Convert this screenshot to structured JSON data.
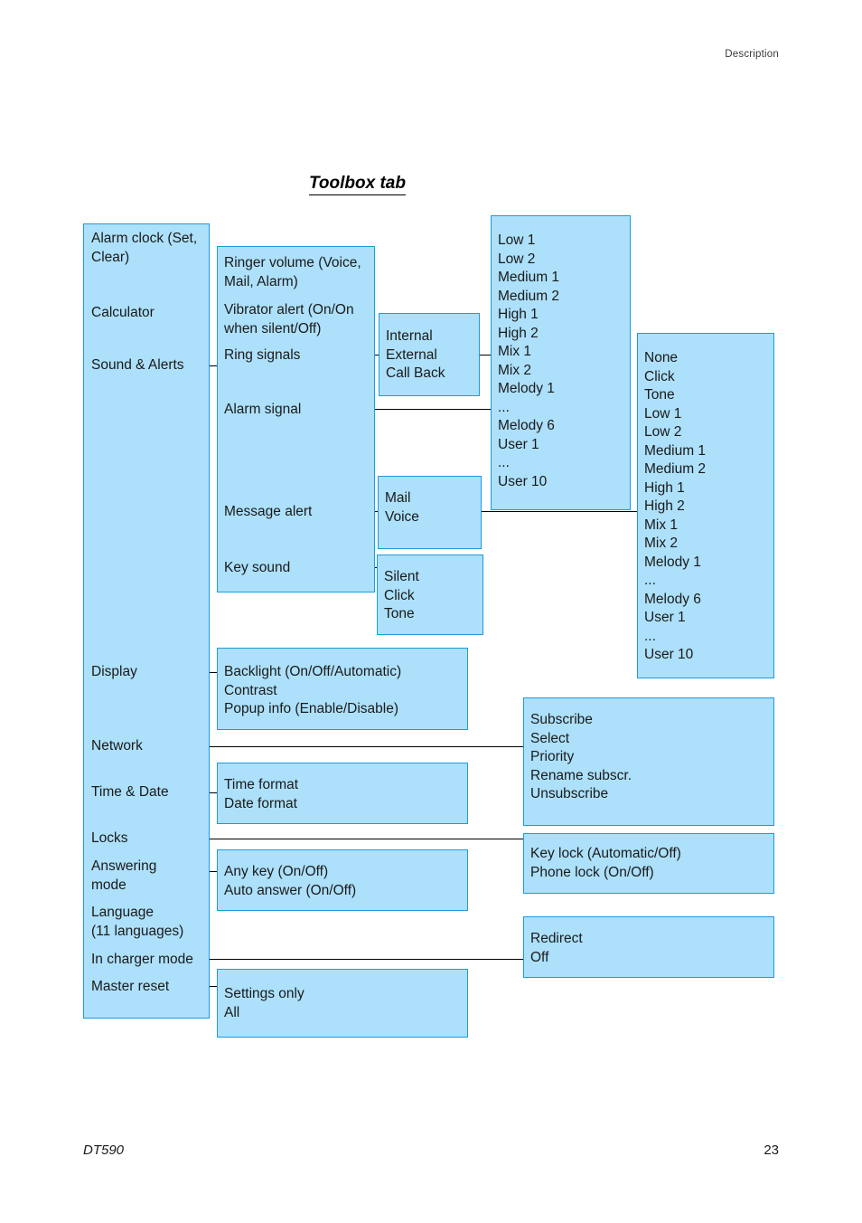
{
  "header": {
    "section_label": "Description"
  },
  "footer": {
    "document_name": "DT590",
    "page_number": "23"
  },
  "diagram": {
    "title": "Toolbox tab",
    "colors": {
      "box_fill": "#ade0fa",
      "box_border": "#1e9ae0",
      "connector": "#000000",
      "text": "#1a1a1a"
    },
    "level1_menu": {
      "items": [
        "Alarm clock (Set,\nClear)",
        "Calculator",
        "Sound & Alerts",
        "Display",
        "Network",
        "Time & Date",
        "Locks",
        "Answering\nmode",
        "Language\n(11 languages)",
        "In charger mode",
        "Master reset"
      ]
    },
    "sound_alerts_submenu": {
      "items": [
        "Ringer volume (Voice,\nMail, Alarm)",
        "Vibrator alert (On/On\nwhen silent/Off)",
        "Ring signals",
        "Alarm signal",
        "Message alert",
        "Key sound"
      ]
    },
    "ring_signals_types": {
      "items": [
        "Internal",
        "External",
        "Call Back"
      ]
    },
    "ring_signal_tones": {
      "items": [
        "Low 1",
        "Low 2",
        "Medium 1",
        "Medium 2",
        "High 1",
        "High 2",
        "Mix 1",
        "Mix 2",
        "Melody 1",
        "...",
        "Melody 6",
        "User 1",
        "...",
        "User 10"
      ]
    },
    "message_alert_types": {
      "items": [
        "Mail",
        "Voice"
      ]
    },
    "message_alert_tones": {
      "items": [
        "None",
        "Click",
        "Tone",
        "Low 1",
        "Low 2",
        "Medium 1",
        "Medium 2",
        "High 1",
        "High 2",
        "Mix 1",
        "Mix 2",
        "Melody 1",
        "...",
        "Melody 6",
        "User 1",
        "...",
        "User 10"
      ]
    },
    "key_sound_options": {
      "items": [
        "Silent",
        "Click",
        "Tone"
      ]
    },
    "display_options": {
      "items": [
        "Backlight (On/Off/Automatic)",
        "Contrast",
        "Popup info (Enable/Disable)"
      ]
    },
    "network_options": {
      "items": [
        "Subscribe",
        "Select",
        "Priority",
        "Rename subscr.",
        "Unsubscribe"
      ]
    },
    "time_date_options": {
      "items": [
        "Time format",
        "Date format"
      ]
    },
    "locks_options": {
      "items": [
        "Key lock (Automatic/Off)",
        "Phone lock (On/Off)"
      ]
    },
    "answering_mode_options": {
      "items": [
        "Any key (On/Off)",
        "Auto answer (On/Off)"
      ]
    },
    "in_charger_mode_options": {
      "items": [
        "Redirect",
        "Off"
      ]
    },
    "master_reset_options": {
      "items": [
        "Settings only",
        "All"
      ]
    }
  },
  "text": {
    "l1_alarm_clock": "Alarm clock (Set,\nClear)",
    "l1_calculator": "Calculator",
    "l1_sound_alerts": "Sound & Alerts",
    "l1_display": "Display",
    "l1_network": "Network",
    "l1_time_date": "Time & Date",
    "l1_locks": "Locks",
    "l1_answering_mode": "Answering\nmode",
    "l1_language": "Language\n(11 languages)",
    "l1_in_charger_mode": "In charger mode",
    "l1_master_reset": "Master reset",
    "sa_ringer_volume": "Ringer volume (Voice,\nMail, Alarm)",
    "sa_vibrator_alert": "Vibrator alert (On/On\nwhen silent/Off)",
    "sa_ring_signals": "Ring signals",
    "sa_alarm_signal": "Alarm signal",
    "sa_message_alert": "Message alert",
    "sa_key_sound": "Key sound",
    "ring_types": "Internal\nExternal\nCall Back",
    "ring_tones": "Low 1\nLow 2\nMedium 1\nMedium 2\nHigh 1\nHigh 2\nMix 1\nMix 2\nMelody 1\n...\nMelody 6\nUser 1\n...\nUser 10",
    "msg_types": "Mail\nVoice",
    "msg_tones": "None\nClick\nTone\nLow 1\nLow 2\nMedium 1\nMedium 2\nHigh 1\nHigh 2\nMix 1\nMix 2\nMelody 1\n...\nMelody 6\nUser 1\n...\nUser 10",
    "key_sound_opts": "Silent\nClick\nTone",
    "display_opts": "Backlight (On/Off/Automatic)\nContrast\nPopup info (Enable/Disable)",
    "network_opts": "Subscribe\nSelect\nPriority\nRename subscr.\nUnsubscribe",
    "time_date_opts": "Time format\nDate format",
    "locks_opts": "Key lock (Automatic/Off)\nPhone lock (On/Off)",
    "answering_opts": "Any key (On/Off)\nAuto answer (On/Off)",
    "charger_opts": "Redirect\nOff",
    "master_reset_opts": "Settings only\nAll"
  }
}
